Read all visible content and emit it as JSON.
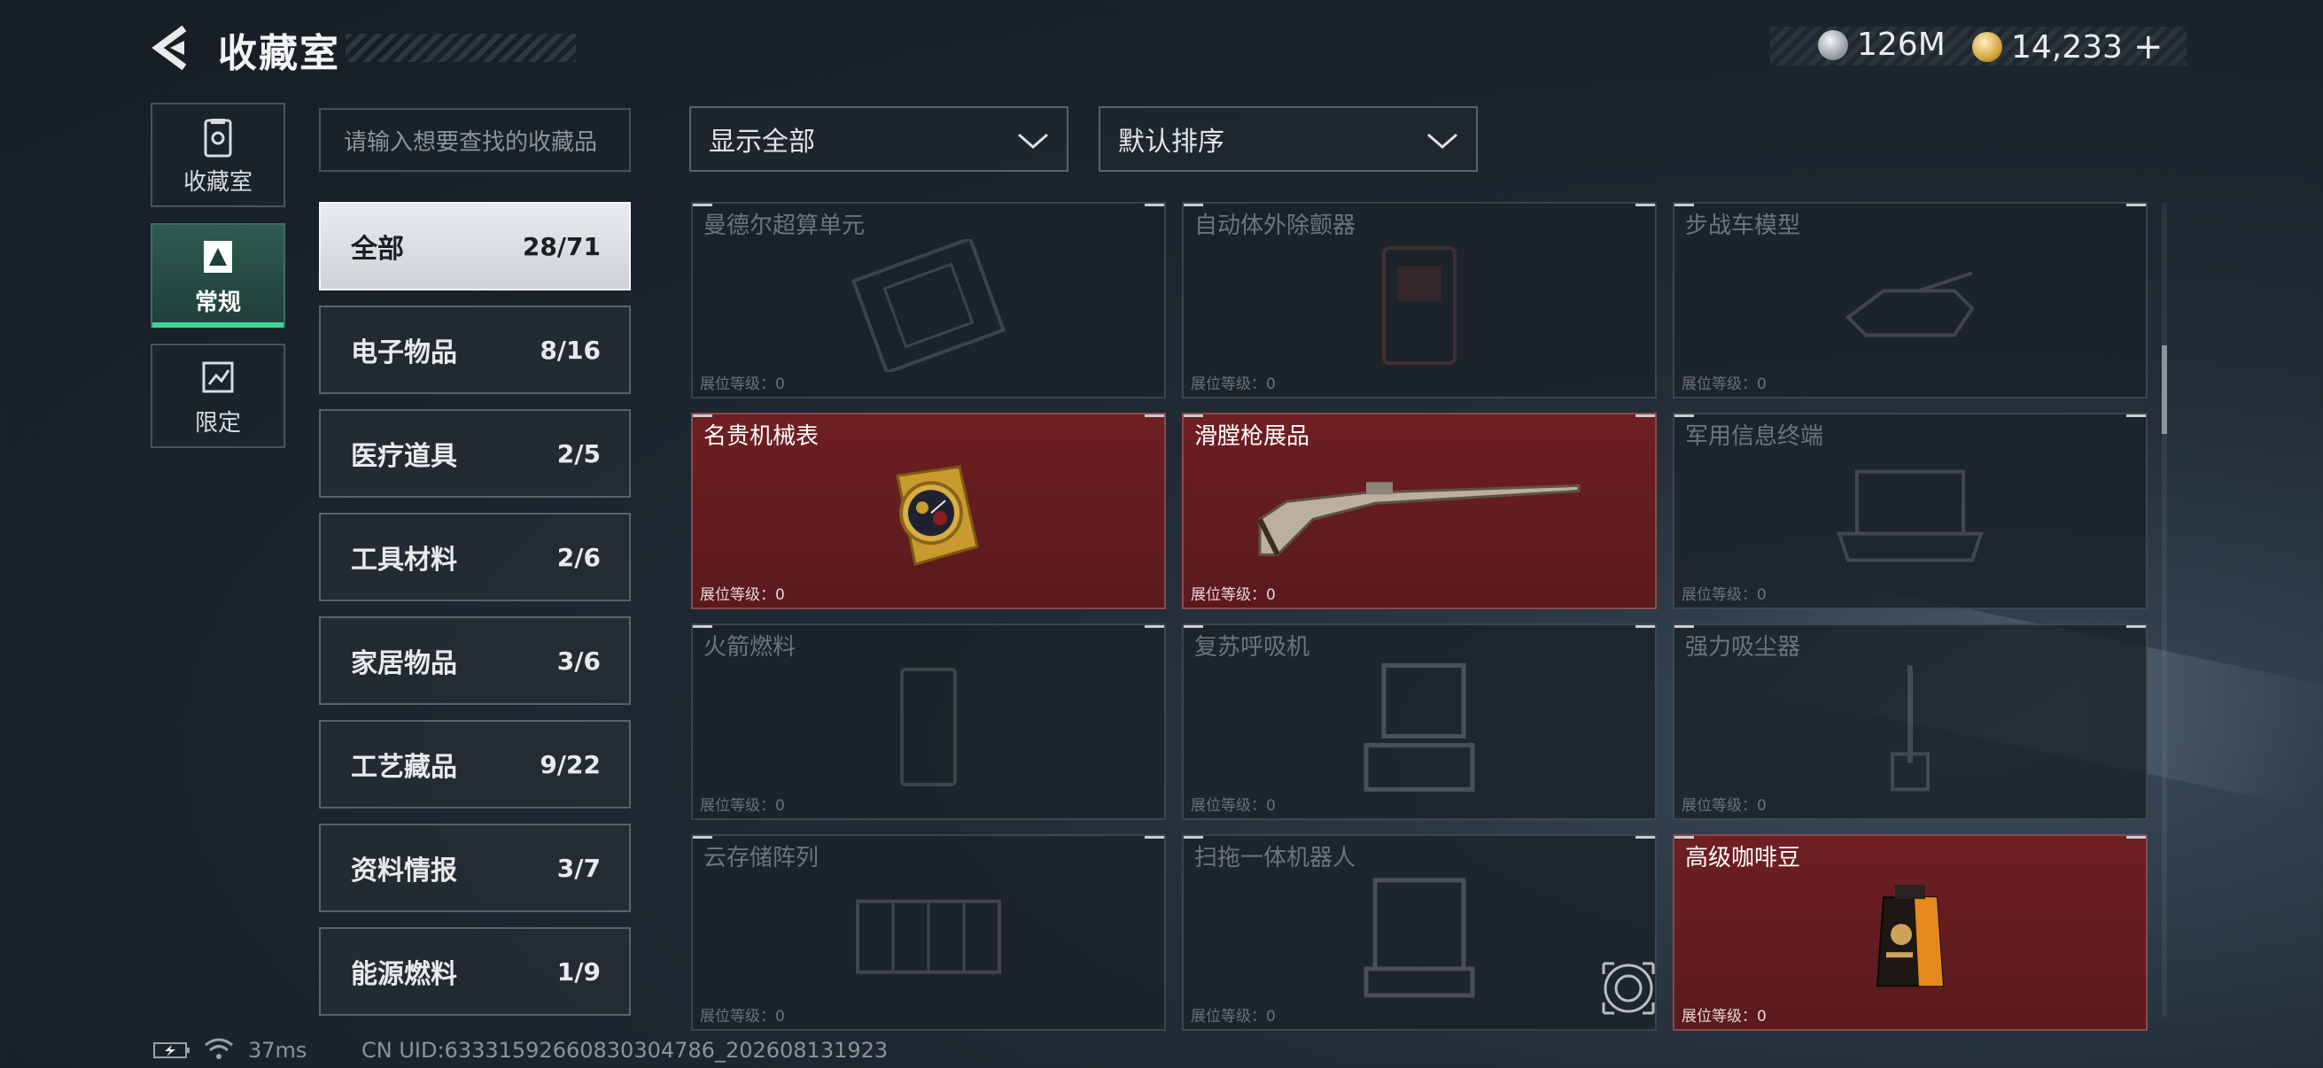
{
  "header": {
    "title": "收藏室",
    "currency": [
      {
        "icon": "silver-coin-icon",
        "value": "126M"
      },
      {
        "icon": "gold-coin-icon",
        "value": "14,233"
      }
    ]
  },
  "sidebar": {
    "tabs": [
      {
        "label": "收藏室",
        "icon": "collection-room-icon",
        "active": false
      },
      {
        "label": "常规",
        "icon": "regular-icon",
        "active": true
      },
      {
        "label": "限定",
        "icon": "limited-icon",
        "active": false
      }
    ]
  },
  "search": {
    "placeholder": "请输入想要查找的收藏品"
  },
  "categories": [
    {
      "name": "全部",
      "count": "28/71",
      "active": true
    },
    {
      "name": "电子物品",
      "count": "8/16"
    },
    {
      "name": "医疗道具",
      "count": "2/5"
    },
    {
      "name": "工具材料",
      "count": "2/6"
    },
    {
      "name": "家居物品",
      "count": "3/6"
    },
    {
      "name": "工艺藏品",
      "count": "9/22"
    },
    {
      "name": "资料情报",
      "count": "3/7"
    },
    {
      "name": "能源燃料",
      "count": "1/9"
    }
  ],
  "filters": {
    "display": "显示全部",
    "sort": "默认排序"
  },
  "items": [
    {
      "name": "曼德尔超算单元",
      "level": "展位等级：0",
      "owned": false
    },
    {
      "name": "自动体外除颤器",
      "level": "展位等级：0",
      "owned": false
    },
    {
      "name": "步战车模型",
      "level": "展位等级：0",
      "owned": false
    },
    {
      "name": "名贵机械表",
      "level": "展位等级：0",
      "owned": true
    },
    {
      "name": "滑膛枪展品",
      "level": "展位等级：0",
      "owned": true
    },
    {
      "name": "军用信息终端",
      "level": "展位等级：0",
      "owned": false
    },
    {
      "name": "火箭燃料",
      "level": "展位等级：0",
      "owned": false
    },
    {
      "name": "复苏呼吸机",
      "level": "展位等级：0",
      "owned": false
    },
    {
      "name": "强力吸尘器",
      "level": "展位等级：0",
      "owned": false
    },
    {
      "name": "云存储阵列",
      "level": "展位等级：0",
      "owned": false
    },
    {
      "name": "扫拖一体机器人",
      "level": "展位等级：0",
      "owned": false
    },
    {
      "name": "高级咖啡豆",
      "level": "展位等级：0",
      "owned": true
    }
  ],
  "status_bar": {
    "ping": "37ms",
    "uid": "CN UID:6333159266083030478​6_202608131923"
  }
}
